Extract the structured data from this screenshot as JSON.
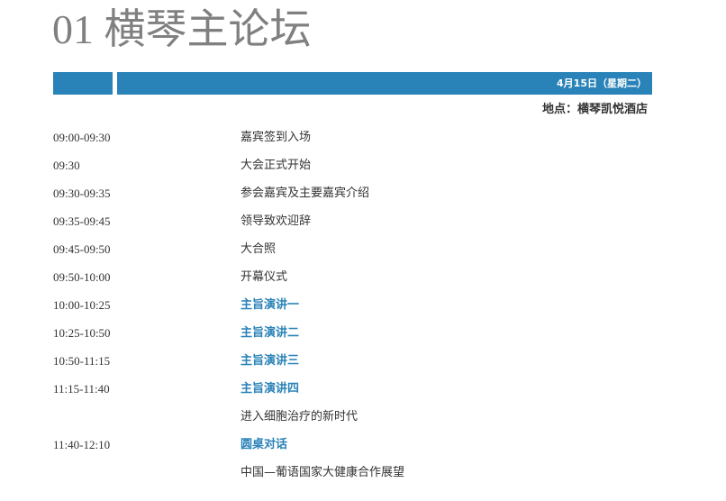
{
  "header": {
    "title": "01 横琴主论坛",
    "date": "4月15日（星期二）",
    "venue": "地点：横琴凯悦酒店"
  },
  "schedule": [
    {
      "time": "09:00-09:30",
      "item": "嘉宾签到入场",
      "highlight": false
    },
    {
      "time": "09:30",
      "item": "大会正式开始",
      "highlight": false
    },
    {
      "time": "09:30-09:35",
      "item": "参会嘉宾及主要嘉宾介绍",
      "highlight": false
    },
    {
      "time": "09:35-09:45",
      "item": "领导致欢迎辞",
      "highlight": false
    },
    {
      "time": "09:45-09:50",
      "item": "大合照",
      "highlight": false
    },
    {
      "time": "09:50-10:00",
      "item": "开幕仪式",
      "highlight": false
    },
    {
      "time": "10:00-10:25",
      "item": "主旨演讲一",
      "highlight": true
    },
    {
      "time": "10:25-10:50",
      "item": "主旨演讲二",
      "highlight": true
    },
    {
      "time": "10:50-11:15",
      "item": "主旨演讲三",
      "highlight": true
    },
    {
      "time": "11:15-11:40",
      "item": "主旨演讲四",
      "highlight": true
    },
    {
      "time": "",
      "item": "进入细胞治疗的新时代",
      "highlight": false
    },
    {
      "time": "11:40-12:10",
      "item": "圆桌对话",
      "highlight": true
    },
    {
      "time": "",
      "item": "中国—葡语国家大健康合作展望",
      "highlight": false
    }
  ]
}
